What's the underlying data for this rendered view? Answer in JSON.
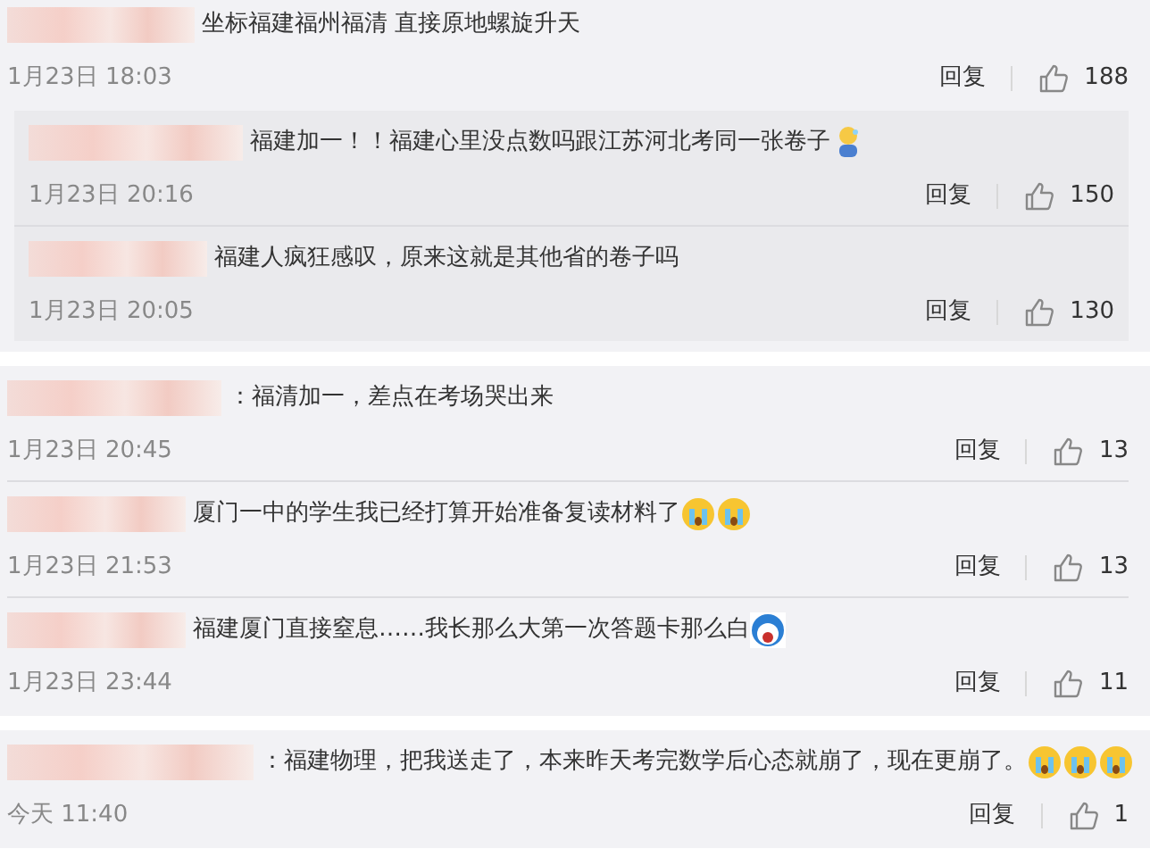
{
  "cards": [
    {
      "comments": [
        {
          "text": "坐标福建福州福清 直接原地螺旋升天",
          "time": "1月23日 18:03",
          "reply": "回复",
          "likes": "188",
          "replies": [
            {
              "text": "福建加一！！福建心里没点数吗跟江苏河北考同一张卷子",
              "time": "1月23日 20:16",
              "reply": "回复",
              "likes": "150",
              "emojis": [
                {
                  "kind": "sweat"
                }
              ]
            },
            {
              "text": "福建人疯狂感叹，原来这就是其他省的卷子吗",
              "time": "1月23日 20:05",
              "reply": "回复",
              "likes": "130"
            }
          ]
        }
      ]
    },
    {
      "comments": [
        {
          "text": "：福清加一，差点在考场哭出来",
          "time": "1月23日 20:45",
          "reply": "回复",
          "likes": "13"
        },
        {
          "text": "厦门一中的学生我已经打算开始准备复读材料了",
          "time": "1月23日 21:53",
          "reply": "回复",
          "likes": "13",
          "emojis": [
            {
              "kind": "crying"
            },
            {
              "kind": "crying"
            }
          ]
        },
        {
          "text": "福建厦门直接窒息……我长那么大第一次答题卡那么白",
          "time": "1月23日 23:44",
          "reply": "回复",
          "likes": "11",
          "emojis": [
            {
              "kind": "shocked"
            }
          ]
        }
      ]
    },
    {
      "comments": [
        {
          "text": "：福建物理，把我送走了，本来昨天考完数学后心态就崩了，现在更崩了。",
          "time": "今天 11:40",
          "reply": "回复",
          "likes": "1",
          "emojis": [
            {
              "kind": "crying"
            },
            {
              "kind": "crying"
            },
            {
              "kind": "crying"
            }
          ]
        }
      ]
    }
  ]
}
